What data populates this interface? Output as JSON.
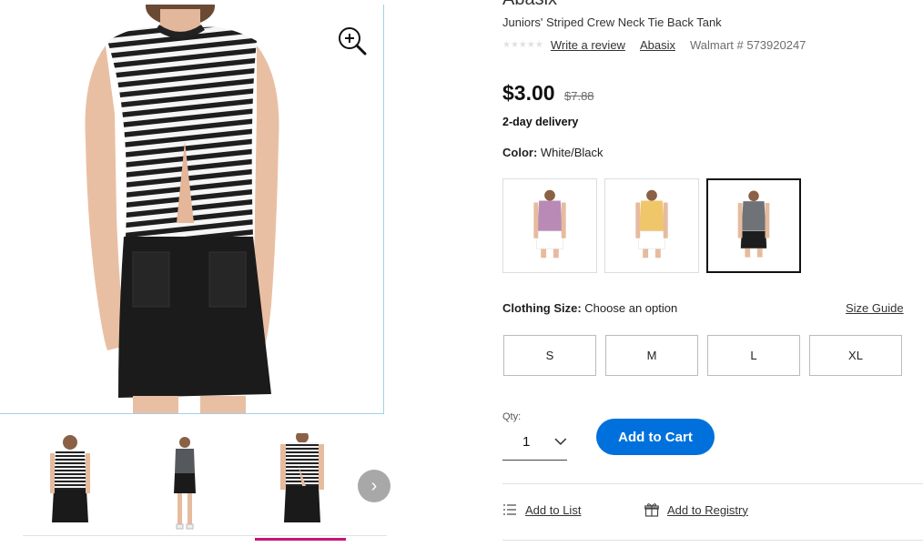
{
  "product": {
    "brand_top": "Abasix",
    "title": "Juniors' Striped Crew Neck Tie Back Tank",
    "rating_stars": "★★★★★",
    "write_review": "Write a review",
    "brand_link": "Abasix",
    "walmart_number": "Walmart # 573920247"
  },
  "pricing": {
    "price": "$3.00",
    "was_price": "$7.88",
    "delivery": "2-day delivery"
  },
  "color": {
    "label": "Color:",
    "value": "White/Black",
    "options": [
      {
        "name": "Purple",
        "shirt_color": "#b98ab5",
        "bottom_color": "#ffffff",
        "selected": false
      },
      {
        "name": "Yellow",
        "shirt_color": "#f0c66b",
        "bottom_color": "#ffffff",
        "selected": false
      },
      {
        "name": "White/Black",
        "shirt_color": "#6f7277",
        "bottom_color": "#1d1d1d",
        "selected": true
      }
    ]
  },
  "size": {
    "label": "Clothing Size:",
    "value": "Choose an option",
    "guide": "Size Guide",
    "options": [
      "S",
      "M",
      "L",
      "XL"
    ]
  },
  "quantity": {
    "label": "Qty:",
    "value": "1"
  },
  "cart": {
    "add_label": "Add to Cart"
  },
  "actions": {
    "list_label": "Add to List",
    "registry_label": "Add to Registry"
  },
  "gallery": {
    "next_arrow": "›",
    "active_thumb": 2
  },
  "colors": {
    "accent_blue": "#0071dc",
    "active_thumb_underline": "#c7167a",
    "image_border": "#9fd1ea"
  },
  "icons": {
    "zoom": "zoom-in-icon",
    "list": "list-icon",
    "registry": "gift-icon",
    "qty": "chevron-down-icon",
    "next": "chevron-right-icon"
  }
}
